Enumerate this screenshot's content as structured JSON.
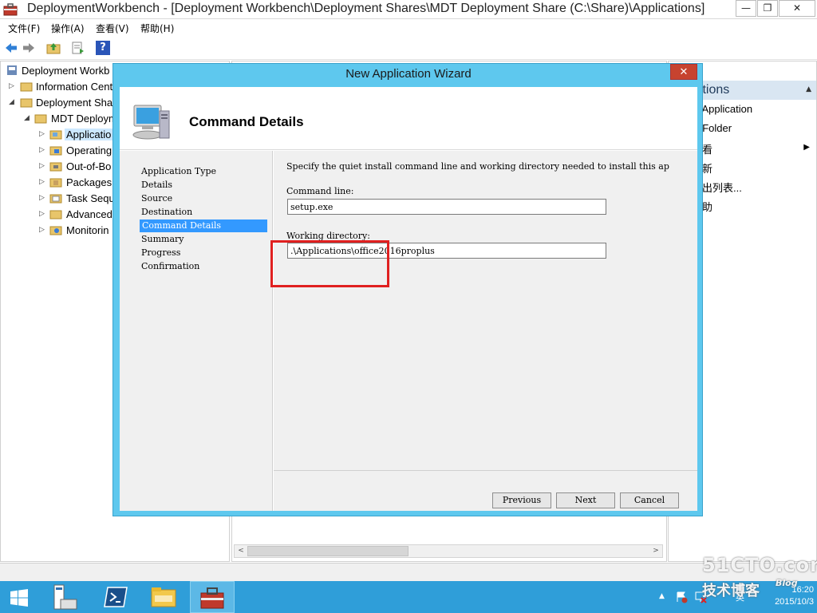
{
  "window": {
    "title": "DeploymentWorkbench - [Deployment Workbench\\Deployment Shares\\MDT Deployment Share (C:\\Share)\\Applications]",
    "min_glyph": "—",
    "max_glyph": "❐",
    "close_glyph": "✕"
  },
  "menu": [
    "文件(F)",
    "操作(A)",
    "查看(V)",
    "帮助(H)"
  ],
  "toolbar": {
    "icons": [
      "back-arrow-icon",
      "forward-arrow-icon",
      "up-folder-icon",
      "export-list-icon",
      "help-icon"
    ],
    "help_glyph": "?"
  },
  "tree": {
    "items": [
      {
        "label": "Deployment Workb",
        "icon": "workbench-icon"
      },
      {
        "label": "Information Cent",
        "icon": "info-folder-icon"
      },
      {
        "label": "Deployment Sha",
        "icon": "folder-icon"
      },
      {
        "label": "MDT Deploym",
        "icon": "folder-icon"
      },
      {
        "label": "Applicatio",
        "icon": "applications-folder-icon"
      },
      {
        "label": "Operating",
        "icon": "os-folder-icon"
      },
      {
        "label": "Out-of-Bo",
        "icon": "drivers-folder-icon"
      },
      {
        "label": "Packages",
        "icon": "packages-folder-icon"
      },
      {
        "label": "Task Sequ",
        "icon": "task-sequence-folder-icon"
      },
      {
        "label": "Advanced",
        "icon": "folder-icon"
      },
      {
        "label": "Monitorin",
        "icon": "monitoring-folder-icon"
      }
    ]
  },
  "actions": {
    "header": "ications",
    "items": [
      "ew Application",
      "ew Folder",
      "看",
      "新",
      "出列表...",
      "助"
    ]
  },
  "dialog": {
    "title": "New Application Wizard",
    "close_glyph": "✕",
    "page_title": "Command Details",
    "steps": [
      "Application Type",
      "Details",
      "Source",
      "Destination",
      "Command Details",
      "Summary",
      "Progress",
      "Confirmation"
    ],
    "active_step": "Command Details",
    "description": "Specify the quiet install command line and working directory needed to install this ap",
    "command_line_label": "Command line:",
    "command_line_value": "setup.exe",
    "working_dir_label": "Working directory:",
    "working_dir_value": ".\\Applications\\office2016proplus",
    "buttons": {
      "previous": "Previous",
      "next": "Next",
      "cancel": "Cancel"
    }
  },
  "taskbar": {
    "time": "16:20",
    "date": "2015/10/3",
    "ime": "英"
  },
  "watermark": {
    "site": "51CTO.com",
    "text": "技术博客",
    "blog": "Blog"
  },
  "colors": {
    "dialog_frame": "#5ec8ee",
    "taskbar": "#2f9ed9",
    "selected_step": "#3399ff",
    "highlight_box": "#e02020",
    "dialog_close": "#c7432f"
  }
}
